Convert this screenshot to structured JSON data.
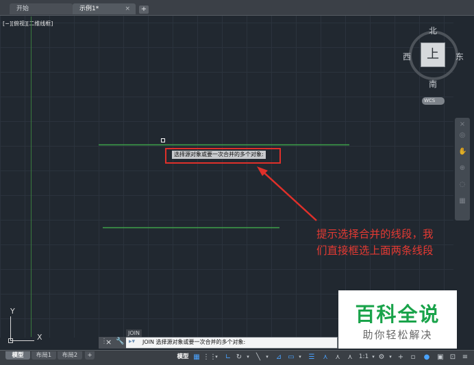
{
  "file_tabs": {
    "items": [
      {
        "label": "开始"
      },
      {
        "label": "示例1*"
      }
    ],
    "close_symbol": "×",
    "add_symbol": "+"
  },
  "viewport": {
    "view_label": "[−][俯视][二维线框]"
  },
  "viewcube": {
    "north": "北",
    "south": "南",
    "west": "西",
    "east": "东",
    "top_face": "上",
    "wcs": "WCS"
  },
  "tooltip": {
    "prompt": "选择源对象或要一次合并的多个对象:"
  },
  "annotation": {
    "line1": "提示选择合并的线段，我",
    "line2": "们直接框选上面两条线段"
  },
  "watermark": {
    "title": "百科全说",
    "subtitle": "助你轻松解决"
  },
  "ucs": {
    "y_label": "Y",
    "x_label": "X"
  },
  "command": {
    "recent": "JOIN",
    "current": "JOIN 选择源对象或要一次合并的多个对象:"
  },
  "layout_tabs": [
    {
      "label": "模型"
    },
    {
      "label": "布局1"
    },
    {
      "label": "布局2"
    }
  ],
  "layout_add": "+",
  "statusbar": {
    "model": "模型",
    "scale": "1:1"
  },
  "colors": {
    "canvas": "#212830",
    "green_line": "#3fa34a",
    "annotation_red": "#e53a33",
    "watermark_green": "#19a34a"
  }
}
